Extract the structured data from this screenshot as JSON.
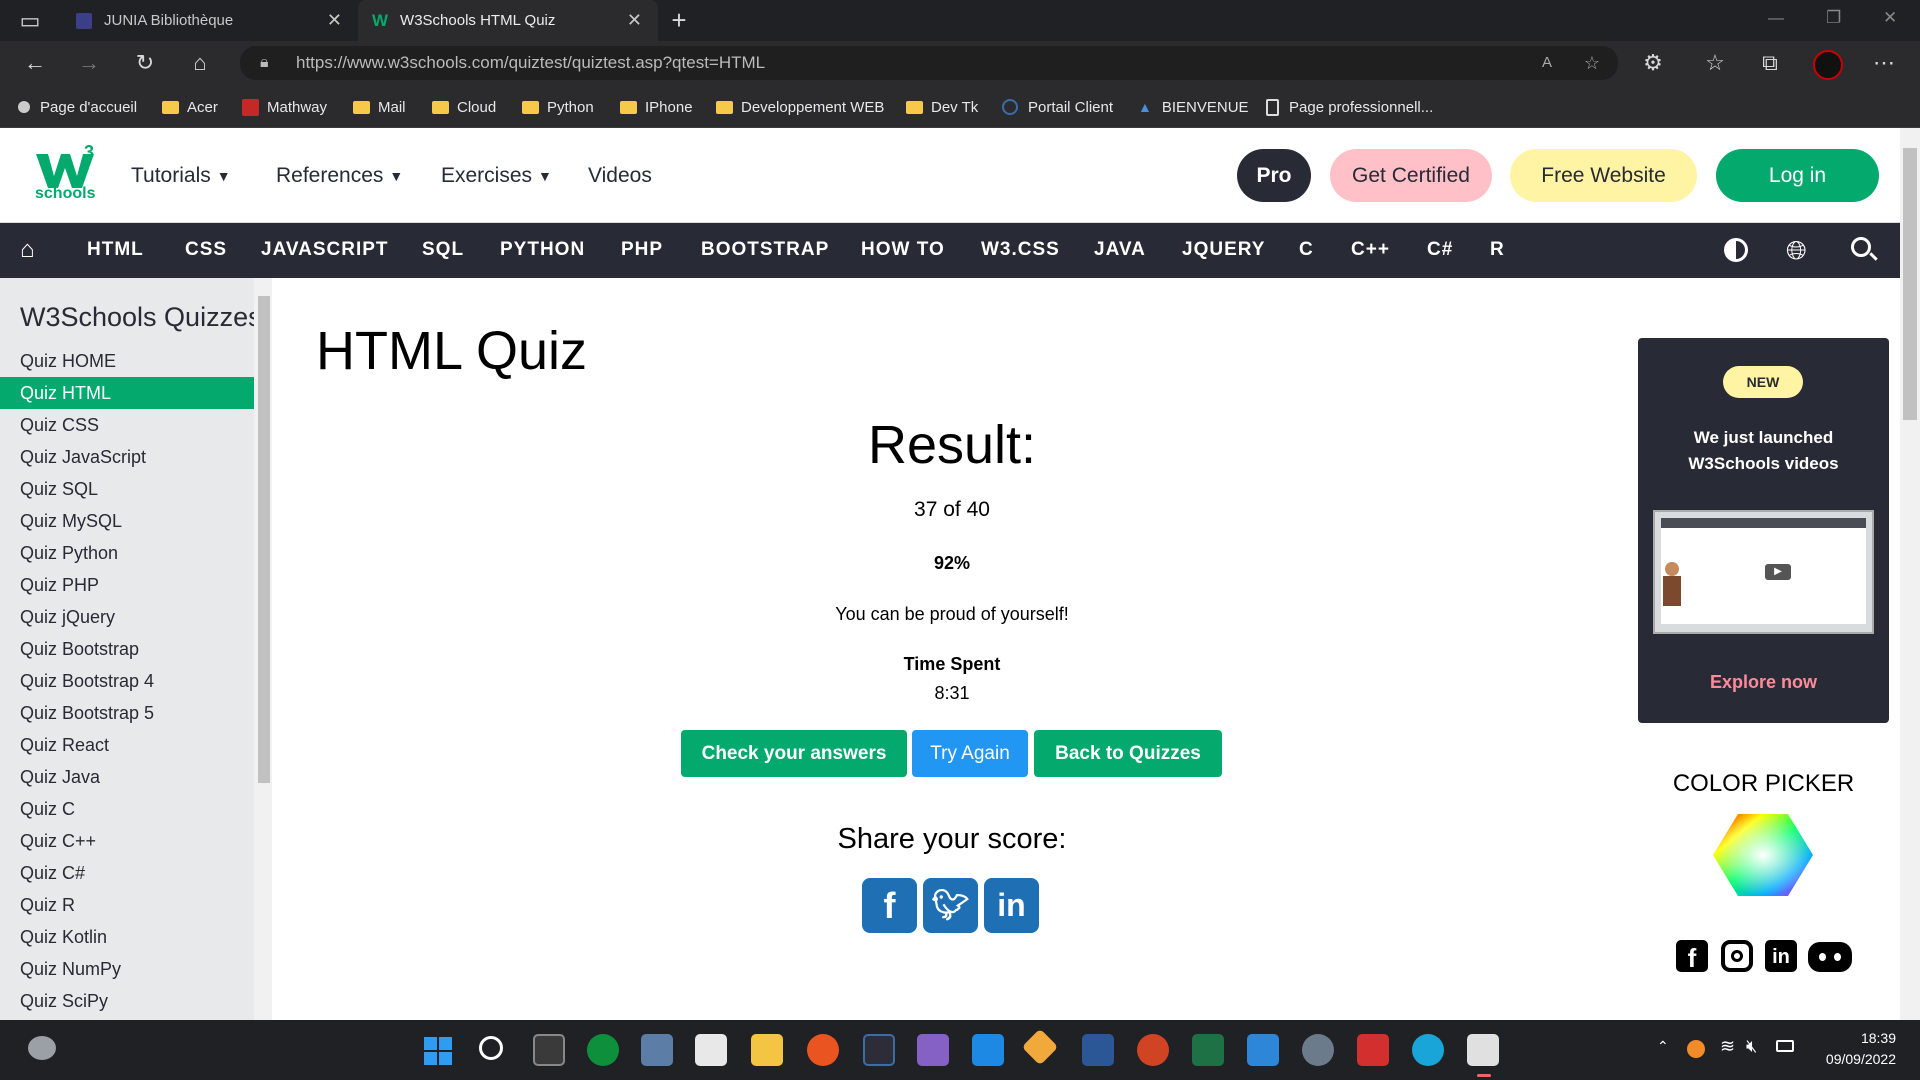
{
  "browser": {
    "tabs": [
      {
        "title": "JUNIA Bibliothèque"
      },
      {
        "title": "W3Schools HTML Quiz"
      }
    ],
    "url": "https://www.w3schools.com/quiztest/quiztest.asp?qtest=HTML",
    "bookmarks": [
      {
        "label": "Page d'accueil",
        "icon": "page-icon"
      },
      {
        "label": "Acer",
        "icon": "folder-icon"
      },
      {
        "label": "Mathway",
        "icon": "mathway-icon"
      },
      {
        "label": "Mail",
        "icon": "folder-icon"
      },
      {
        "label": "Cloud",
        "icon": "folder-icon"
      },
      {
        "label": "Python",
        "icon": "folder-icon"
      },
      {
        "label": "IPhone",
        "icon": "folder-icon"
      },
      {
        "label": "Developpement WEB",
        "icon": "folder-icon"
      },
      {
        "label": "Dev Tk",
        "icon": "folder-icon"
      },
      {
        "label": "Portail Client",
        "icon": "portal-icon"
      },
      {
        "label": "BIENVENUE",
        "icon": "site-icon"
      },
      {
        "label": "Page professionnell...",
        "icon": "document-icon"
      }
    ]
  },
  "header": {
    "logo_text": "schools",
    "logo_super": "3",
    "nav": [
      {
        "label": "Tutorials"
      },
      {
        "label": "References"
      },
      {
        "label": "Exercises"
      },
      {
        "label": "Videos"
      }
    ],
    "pro_label": "Pro",
    "certified_label": "Get Certified",
    "free_website_label": "Free Website",
    "login_label": "Log in"
  },
  "topnav": [
    "HTML",
    "CSS",
    "JAVASCRIPT",
    "SQL",
    "PYTHON",
    "PHP",
    "BOOTSTRAP",
    "HOW TO",
    "W3.CSS",
    "JAVA",
    "JQUERY",
    "C",
    "C++",
    "C#",
    "R"
  ],
  "sidebar": {
    "title": "W3Schools Quizzes",
    "items": [
      "Quiz HOME",
      "Quiz HTML",
      "Quiz CSS",
      "Quiz JavaScript",
      "Quiz SQL",
      "Quiz MySQL",
      "Quiz Python",
      "Quiz PHP",
      "Quiz jQuery",
      "Quiz Bootstrap",
      "Quiz Bootstrap 4",
      "Quiz Bootstrap 5",
      "Quiz React",
      "Quiz Java",
      "Quiz C",
      "Quiz C++",
      "Quiz C#",
      "Quiz R",
      "Quiz Kotlin",
      "Quiz NumPy",
      "Quiz SciPy"
    ],
    "active_index": 1
  },
  "main": {
    "title": "HTML Quiz",
    "result_label": "Result:",
    "score": "37 of 40",
    "percent": "92%",
    "message": "You can be proud of yourself!",
    "time_label": "Time Spent",
    "time_value": "8:31",
    "buttons": {
      "check": "Check your answers",
      "retry": "Try Again",
      "back": "Back to Quizzes"
    },
    "share_label": "Share your score:"
  },
  "ad": {
    "badge": "NEW",
    "line1": "We just launched",
    "line2": "W3Schools videos",
    "cta": "Explore now"
  },
  "color_picker": {
    "title": "COLOR PICKER"
  },
  "taskbar": {
    "time": "18:39",
    "date": "09/09/2022"
  },
  "colors": {
    "green": "#04aa6d",
    "dark": "#282a35",
    "blue": "#2196f3",
    "pink": "#ffc0c7",
    "yellow": "#fff4a3"
  }
}
